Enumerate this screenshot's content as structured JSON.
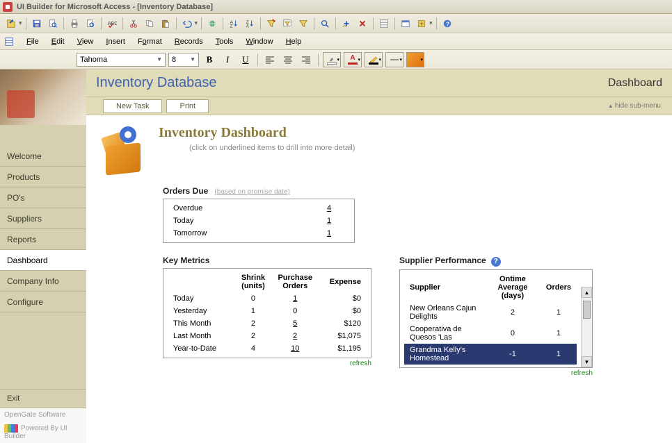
{
  "window": {
    "title": "UI Builder for Microsoft Access - [Inventory Database]"
  },
  "menu": {
    "items": [
      "File",
      "Edit",
      "View",
      "Insert",
      "Format",
      "Records",
      "Tools",
      "Window",
      "Help"
    ]
  },
  "format_bar": {
    "font": "Tahoma",
    "size": "8"
  },
  "header": {
    "title": "Inventory Database",
    "page": "Dashboard"
  },
  "subbar": {
    "buttons": [
      "New Task",
      "Print"
    ],
    "hide": "hide sub-menu"
  },
  "sidebar": {
    "items": [
      "Welcome",
      "Products",
      "PO's",
      "Suppliers",
      "Reports",
      "Dashboard",
      "Company Info",
      "Configure"
    ],
    "active_index": 5,
    "exit": "Exit",
    "vendor": "OpenGate Software",
    "powered": "Powered By UI Builder"
  },
  "dashboard": {
    "title": "Inventory Dashboard",
    "subtitle": "(click on underlined items to drill into more detail)",
    "orders_due": {
      "title": "Orders Due",
      "note": "(based on promise date)",
      "rows": [
        {
          "label": "Overdue",
          "value": "4"
        },
        {
          "label": "Today",
          "value": "1"
        },
        {
          "label": "Tomorrow",
          "value": "1"
        }
      ]
    },
    "key_metrics": {
      "title": "Key Metrics",
      "headers": [
        "",
        "Shrink (units)",
        "Purchase Orders",
        "Expense"
      ],
      "rows": [
        {
          "label": "Today",
          "shrink": "0",
          "po": "1",
          "expense": "$0"
        },
        {
          "label": "Yesterday",
          "shrink": "1",
          "po": "0",
          "expense": "$0"
        },
        {
          "label": "This Month",
          "shrink": "2",
          "po": "5",
          "expense": "$120"
        },
        {
          "label": "Last Month",
          "shrink": "2",
          "po": "2",
          "expense": "$1,075"
        },
        {
          "label": "Year-to-Date",
          "shrink": "4",
          "po": "10",
          "expense": "$1,195"
        }
      ],
      "refresh": "refresh"
    },
    "supplier_perf": {
      "title": "Supplier Performance",
      "headers": [
        "Supplier",
        "Ontime Average (days)",
        "Orders"
      ],
      "rows": [
        {
          "name": "New Orleans Cajun Delights",
          "ontime": "2",
          "orders": "1"
        },
        {
          "name": "Cooperativa de Quesos 'Las",
          "ontime": "0",
          "orders": "1"
        },
        {
          "name": "Grandma Kelly's Homestead",
          "ontime": "-1",
          "orders": "1"
        }
      ],
      "selected_index": 2,
      "refresh": "refresh"
    }
  }
}
